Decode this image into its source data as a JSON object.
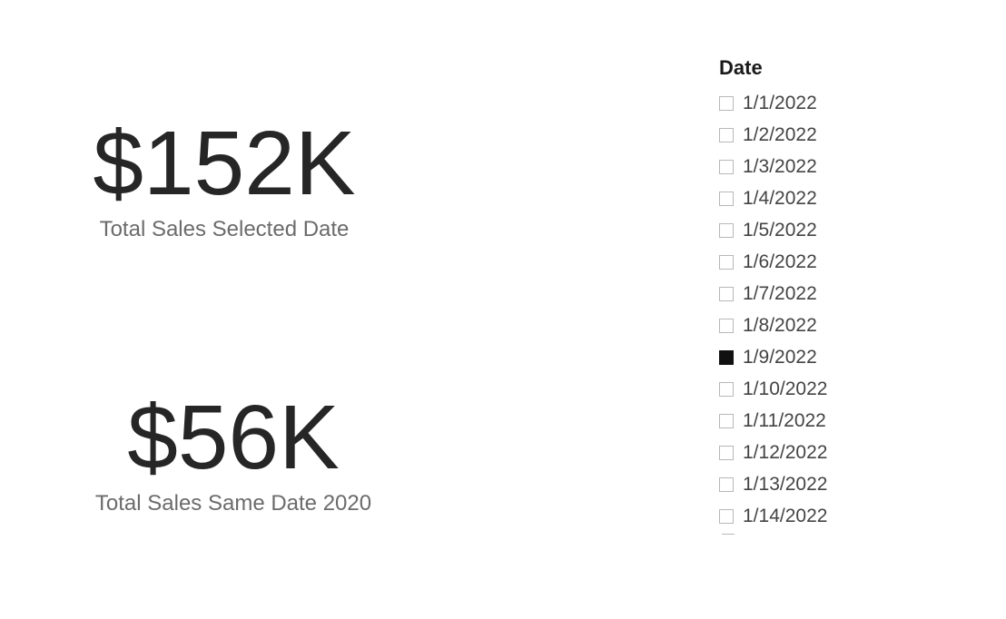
{
  "kpi": {
    "selected": {
      "value": "$152K",
      "label": "Total Sales Selected Date"
    },
    "same_2020": {
      "value": "$56K",
      "label": "Total Sales Same Date 2020"
    }
  },
  "slicer": {
    "title": "Date",
    "items": [
      {
        "label": "1/1/2022",
        "checked": false
      },
      {
        "label": "1/2/2022",
        "checked": false
      },
      {
        "label": "1/3/2022",
        "checked": false
      },
      {
        "label": "1/4/2022",
        "checked": false
      },
      {
        "label": "1/5/2022",
        "checked": false
      },
      {
        "label": "1/6/2022",
        "checked": false
      },
      {
        "label": "1/7/2022",
        "checked": false
      },
      {
        "label": "1/8/2022",
        "checked": false
      },
      {
        "label": "1/9/2022",
        "checked": true
      },
      {
        "label": "1/10/2022",
        "checked": false
      },
      {
        "label": "1/11/2022",
        "checked": false
      },
      {
        "label": "1/12/2022",
        "checked": false
      },
      {
        "label": "1/13/2022",
        "checked": false
      },
      {
        "label": "1/14/2022",
        "checked": false
      }
    ]
  }
}
